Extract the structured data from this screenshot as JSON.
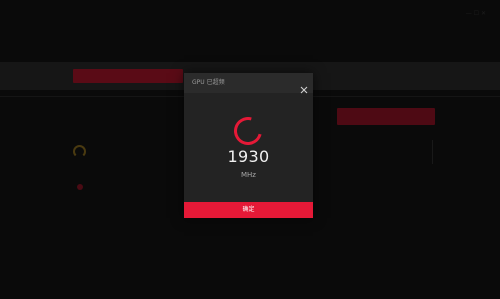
{
  "dialog": {
    "title": "GPU 已超频",
    "close_icon": "close-icon",
    "progress_icon": "loading-spinner-icon",
    "value": "1930",
    "unit": "MHz",
    "confirm_label": "确定"
  },
  "colors": {
    "accent": "#e51937",
    "dialog_bg": "#232323",
    "dialog_header_bg": "#2b2b2b",
    "page_bg": "#0a0a0a"
  }
}
